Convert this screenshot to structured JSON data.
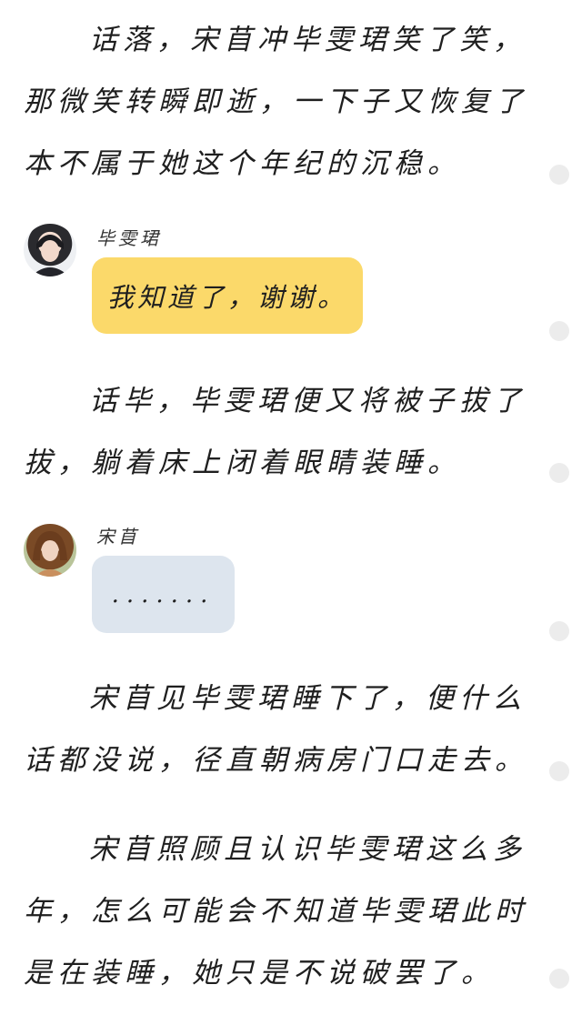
{
  "story": {
    "para1": "话落，宋苜冲毕雯珺笑了笑，那微笑转瞬即逝，一下子又恢复了本不属于她这个年纪的沉稳。",
    "para2": "话毕，毕雯珺便又将被子拔了拔，躺着床上闭着眼睛装睡。",
    "para3": "宋苜见毕雯珺睡下了，便什么话都没说，径直朝病房门口走去。",
    "para4": "宋苜照顾且认识毕雯珺这么多年，怎么可能会不知道毕雯珺此时是在装睡，她只是不说破罢了。"
  },
  "messages": [
    {
      "speaker": "毕雯珺",
      "text": "我知道了，谢谢。",
      "bubble_color": "#fbd96a"
    },
    {
      "speaker": "宋苜",
      "text": ".......",
      "bubble_color": "#dde5ee"
    }
  ],
  "colors": {
    "background": "#ffffff",
    "text": "#1f1f1f",
    "scroll_dot": "#ececec"
  }
}
